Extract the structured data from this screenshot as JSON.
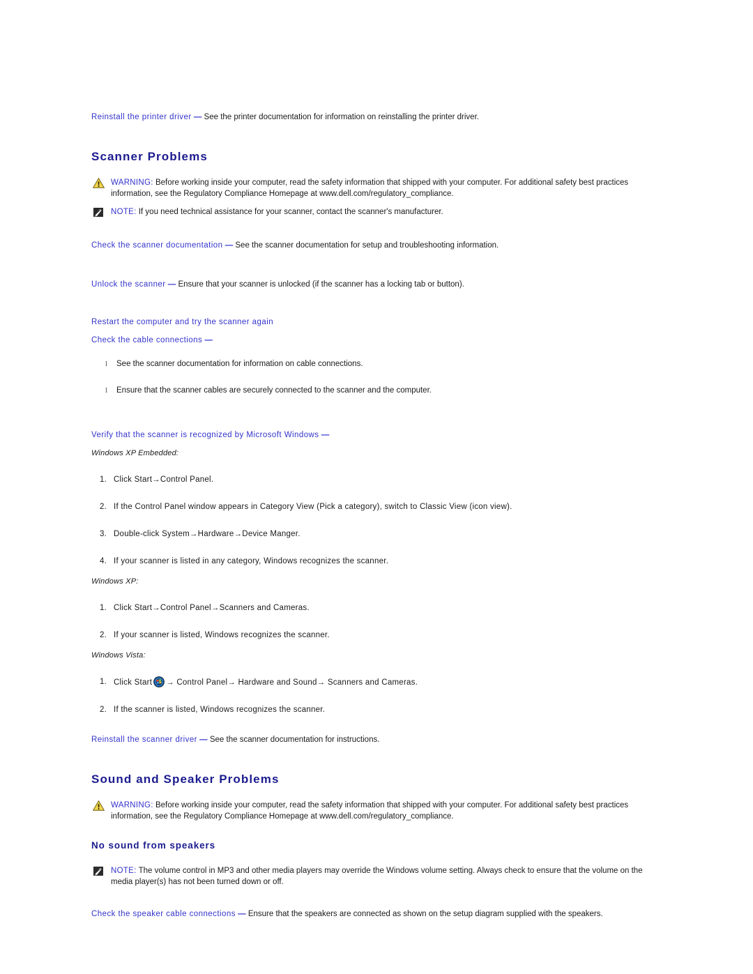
{
  "page": {
    "background_color": "#ffffff",
    "heading_color": "#1b1b8f",
    "link_blue": "#3333cc",
    "body_color": "#1a1a1a"
  },
  "printer_driver": {
    "lead": "Reinstall the printer driver",
    "dash": "—",
    "body": "See the printer documentation for information on reinstalling the printer driver."
  },
  "scanner": {
    "title": "Scanner Problems",
    "warning": {
      "label": "WARNING:",
      "text": "Before working inside your computer, read the safety information that shipped with your computer. For additional safety best practices information, see the Regulatory Compliance Homepage at www.dell.com/regulatory_compliance."
    },
    "note": {
      "label": "NOTE:",
      "text": "If you need technical assistance for your scanner, contact the scanner's manufacturer."
    },
    "check_documentation": {
      "lead": "Check the scanner documentation",
      "dash": "—",
      "body": "See the scanner documentation for setup and troubleshooting information."
    },
    "unlock_scanner": {
      "lead": "Unlock the scanner",
      "dash": "—",
      "body": "Ensure that your scanner is unlocked (if the scanner has a locking tab or button)."
    },
    "restart_computer": "Restart the computer and try the scanner again",
    "check_cables": {
      "lead": "Check the cable connections",
      "dash": "—"
    },
    "cable_bullets": [
      "See the scanner documentation for information on cable connections.",
      "Ensure that the scanner cables are securely connected to the scanner and the computer."
    ],
    "verify_recognized": {
      "lead": "Verify that the scanner is recognized by Microsoft Windows",
      "dash": "—"
    },
    "xp_embedded": {
      "os_label": "Windows XP Embedded:",
      "steps": [
        {
          "num": "1.",
          "parts": [
            "Click Start",
            "→",
            "Control Panel."
          ]
        },
        {
          "num": "2.",
          "parts": [
            "If the Control Panel window appears in Category View (Pick a category), switch to Classic View (icon view)."
          ]
        },
        {
          "num": "3.",
          "parts": [
            "Double-click System",
            "→",
            "Hardware",
            "→",
            "Device Manger."
          ]
        },
        {
          "num": "4.",
          "parts": [
            "If your scanner is listed in any category, Windows recognizes the scanner."
          ]
        }
      ]
    },
    "xp": {
      "os_label": "Windows XP:",
      "steps": [
        {
          "num": "1.",
          "parts": [
            "Click Start",
            "→",
            "Control Panel",
            "→",
            "Scanners and Cameras."
          ]
        },
        {
          "num": "2.",
          "parts": [
            "If your scanner is listed, Windows recognizes the scanner."
          ]
        }
      ]
    },
    "vista": {
      "os_label": "Windows Vista:",
      "step1": {
        "num": "1.",
        "before_orb": "Click Start",
        "orb_icon": "windows-vista-start-orb",
        "after_orb": "→ Control Panel→ Hardware and Sound→ Scanners and Cameras."
      },
      "step2": {
        "num": "2.",
        "text": "If the scanner is listed, Windows recognizes the scanner."
      }
    },
    "reinstall_driver": {
      "lead": "Reinstall the scanner driver",
      "dash": "—",
      "body": "See the scanner documentation for instructions."
    }
  },
  "sound": {
    "title": "Sound and Speaker Problems",
    "warning": {
      "label": "WARNING:",
      "text": "Before working inside your computer, read the safety information that shipped with your computer. For additional safety best practices information, see the Regulatory Compliance Homepage at www.dell.com/regulatory_compliance."
    },
    "subtitle": "No sound from speakers",
    "note": {
      "label": "NOTE:",
      "text": "The volume control in MP3 and other media players may override the Windows volume setting. Always check to ensure that the volume on the media player(s) has not been turned down or off."
    },
    "check_speaker_cables": {
      "lead": "Check the speaker cable connections",
      "dash": "—",
      "body": "Ensure that the speakers are connected as shown on the setup diagram supplied with the speakers."
    }
  },
  "icons": {
    "warning": "warning-triangle-icon",
    "note": "note-pencil-icon",
    "bullet": "l",
    "arrow": "→"
  }
}
